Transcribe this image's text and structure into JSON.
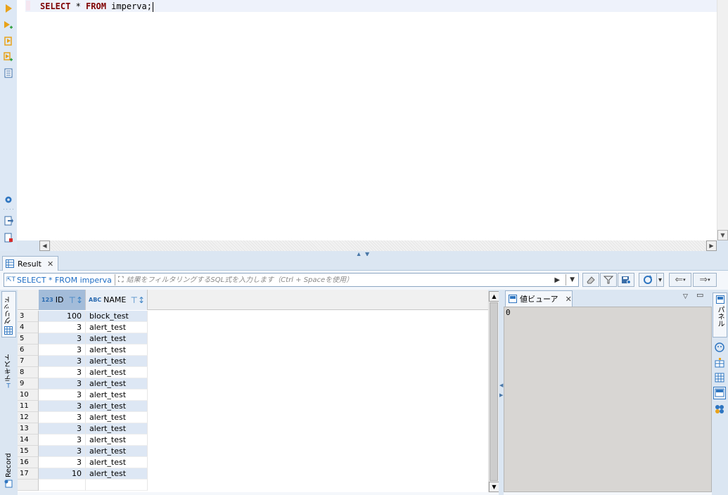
{
  "editor": {
    "sql_keyword_select": "SELECT",
    "sql_star": " * ",
    "sql_keyword_from": "FROM",
    "sql_rest": " imperva;"
  },
  "result": {
    "tab_label": "Result",
    "filter_sql": "SELECT * FROM imperva",
    "filter_placeholder": "結果をフィルタリングするSQL式を入力します（Ctrl + Spaceを使用）"
  },
  "left_tabs": {
    "grid": "グリッド",
    "text": "テキスト",
    "record": "Record"
  },
  "grid": {
    "columns": [
      {
        "type": "123",
        "label": "ID"
      },
      {
        "type": "ABC",
        "label": "NAME"
      }
    ],
    "rows": [
      {
        "row": "3",
        "id": "100",
        "name": "block_test"
      },
      {
        "row": "4",
        "id": "3",
        "name": "alert_test"
      },
      {
        "row": "5",
        "id": "3",
        "name": "alert_test"
      },
      {
        "row": "6",
        "id": "3",
        "name": "alert_test"
      },
      {
        "row": "7",
        "id": "3",
        "name": "alert_test"
      },
      {
        "row": "8",
        "id": "3",
        "name": "alert_test"
      },
      {
        "row": "9",
        "id": "3",
        "name": "alert_test"
      },
      {
        "row": "10",
        "id": "3",
        "name": "alert_test"
      },
      {
        "row": "11",
        "id": "3",
        "name": "alert_test"
      },
      {
        "row": "12",
        "id": "3",
        "name": "alert_test"
      },
      {
        "row": "13",
        "id": "3",
        "name": "alert_test"
      },
      {
        "row": "14",
        "id": "3",
        "name": "alert_test"
      },
      {
        "row": "15",
        "id": "3",
        "name": "alert_test"
      },
      {
        "row": "16",
        "id": "3",
        "name": "alert_test"
      },
      {
        "row": "17",
        "id": "10",
        "name": "alert_test"
      }
    ]
  },
  "value_viewer": {
    "tab_label": "値ビューア",
    "value": "0"
  },
  "right_tabs": {
    "panel": "パネル"
  },
  "colors": {
    "accent": "#3b82c4",
    "keyword": "#7f0000",
    "selected_header": "#a3bcd9",
    "row_stripe": "#dde7f4"
  }
}
